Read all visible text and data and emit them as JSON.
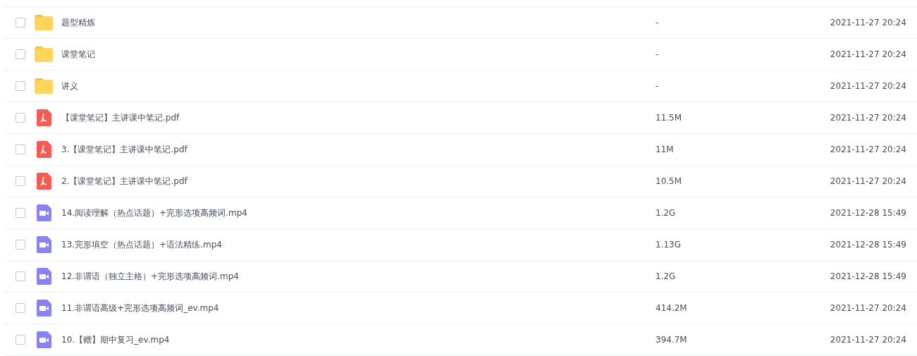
{
  "files": [
    {
      "kind": "folder",
      "name": "题型精炼",
      "size": "-",
      "modified": "2021-11-27 20:24",
      "checked": false
    },
    {
      "kind": "folder",
      "name": "课堂笔记",
      "size": "-",
      "modified": "2021-11-27 20:24",
      "checked": false
    },
    {
      "kind": "folder",
      "name": "讲义",
      "size": "-",
      "modified": "2021-11-27 20:24",
      "checked": false
    },
    {
      "kind": "pdf",
      "name": "【课堂笔记】主讲课中笔记.pdf",
      "size": "11.5M",
      "modified": "2021-11-27 20:24",
      "checked": false
    },
    {
      "kind": "pdf",
      "name": "3.【课堂笔记】主讲课中笔记.pdf",
      "size": "11M",
      "modified": "2021-11-27 20:24",
      "checked": false
    },
    {
      "kind": "pdf",
      "name": "2.【课堂笔记】主讲课中笔记.pdf",
      "size": "10.5M",
      "modified": "2021-11-27 20:24",
      "checked": false
    },
    {
      "kind": "video",
      "name": "14.阅读理解（热点话题）+完形选项高频词.mp4",
      "size": "1.2G",
      "modified": "2021-12-28 15:49",
      "checked": false
    },
    {
      "kind": "video",
      "name": "13.完形填空（热点话题）+语法精练.mp4",
      "size": "1.13G",
      "modified": "2021-12-28 15:49",
      "checked": false
    },
    {
      "kind": "video",
      "name": "12.非谓语（独立主格）+完形选项高频词.mp4",
      "size": "1.2G",
      "modified": "2021-12-28 15:49",
      "checked": false
    },
    {
      "kind": "video",
      "name": "11.非谓语高级+完形选项高频词_ev.mp4",
      "size": "414.2M",
      "modified": "2021-11-27 20:24",
      "checked": false
    },
    {
      "kind": "video",
      "name": "10.【赠】期中复习_ev.mp4",
      "size": "394.7M",
      "modified": "2021-11-27 20:24",
      "checked": false
    }
  ]
}
